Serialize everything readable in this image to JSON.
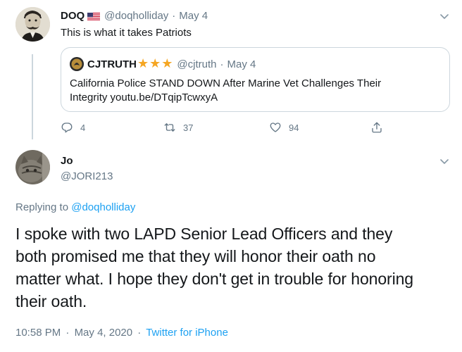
{
  "parent_tweet": {
    "display_name": "DOQ",
    "flag_emoji": "🇺🇸",
    "handle": "@doqholliday",
    "separator": "·",
    "date": "May 4",
    "text": "This is what it takes Patriots",
    "quoted": {
      "display_name": "CJTRUTH",
      "stars": "★★★",
      "handle": "@cjtruth",
      "separator": "·",
      "date": "May 4",
      "text_line1": "California Police STAND DOWN After Marine Vet Challenges Their",
      "text_line2": "Integrity youtu.be/DTqipTcwxyA"
    },
    "actions": {
      "reply_count": "4",
      "retweet_count": "37",
      "like_count": "94"
    }
  },
  "main_tweet": {
    "display_name": "Jo",
    "handle": "@JORI213",
    "replying_prefix": "Replying to",
    "replying_to": "@doqholliday",
    "text_lines": [
      "I spoke with two LAPD Senior Lead Officers and they",
      "both promised me that they will honor their oath no",
      "matter what. I hope they don't get in trouble for honoring",
      "their oath."
    ],
    "time": "10:58 PM",
    "separator": "·",
    "date": "May 4, 2020",
    "separator2": "·",
    "source": "Twitter for iPhone"
  },
  "colors": {
    "link": "#1da1f2",
    "muted": "#657786",
    "text": "#14171a",
    "star": "#f5a623"
  }
}
